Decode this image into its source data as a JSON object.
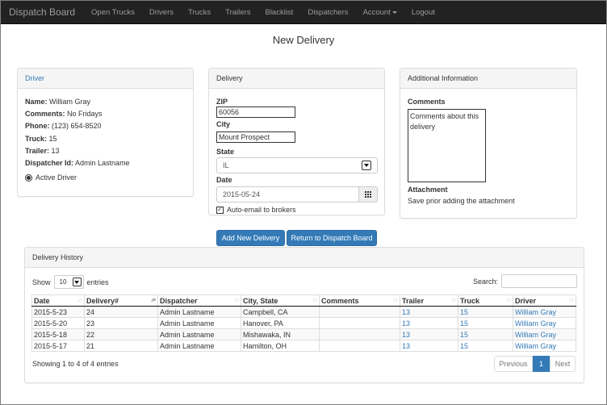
{
  "navbar": {
    "brand": "Dispatch Board",
    "items": [
      "Open Trucks",
      "Drivers",
      "Trucks",
      "Trailers",
      "Blacklist",
      "Dispatchers"
    ],
    "account": "Account",
    "logout": "Logout"
  },
  "page_title": "New Delivery",
  "driver_panel": {
    "heading": "Driver",
    "name_label": "Name:",
    "name": "William Gray",
    "comments_label": "Comments:",
    "comments": "No Fridays",
    "phone_label": "Phone:",
    "phone": "(123) 654-8520",
    "truck_label": "Truck:",
    "truck": "15",
    "trailer_label": "Trailer:",
    "trailer": "13",
    "dispatcher_label": "Dispatcher Id:",
    "dispatcher": "Admin Lastname",
    "active_label": "Active Driver"
  },
  "delivery_panel": {
    "heading": "Delivery",
    "zip_label": "ZIP",
    "zip": "60056",
    "city_label": "City",
    "city": "Mount Prospect",
    "state_label": "State",
    "state": "IL",
    "date_label": "Date",
    "date": "2015-05-24",
    "auto_email_label": "Auto-email to brokers",
    "auto_email_checked": true
  },
  "info_panel": {
    "heading": "Additional Information",
    "comments_label": "Comments",
    "comments_placeholder": "Comments about this delivery",
    "attachment_label": "Attachment",
    "attachment_note": "Save prior adding the attachment"
  },
  "buttons": {
    "add": "Add New Delivery",
    "return": "Return to Dispatch Board"
  },
  "history": {
    "heading": "Delivery History",
    "show_label": "Show",
    "entries_value": "10",
    "entries_label": "entries",
    "search_label": "Search:",
    "columns": [
      "Date",
      "Delivery#",
      "Dispatcher",
      "City, State",
      "Comments",
      "Trailer",
      "Truck",
      "Driver"
    ],
    "rows": [
      [
        "2015-5-23",
        "24",
        "Admin Lastname",
        "Campbell, CA",
        "",
        "13",
        "15",
        "William Gray"
      ],
      [
        "2015-5-20",
        "23",
        "Admin Lastname",
        "Hanover, PA",
        "",
        "13",
        "15",
        "William Gray"
      ],
      [
        "2015-5-18",
        "22",
        "Admin Lastname",
        "Mishawaka, IN",
        "",
        "13",
        "15",
        "William Gray"
      ],
      [
        "2015-5-17",
        "21",
        "Admin Lastname",
        "Hamilton, OH",
        "",
        "13",
        "15",
        "William Gray"
      ]
    ],
    "info": "Showing 1 to 4 of 4 entries",
    "pager": {
      "previous": "Previous",
      "page": "1",
      "next": "Next"
    }
  },
  "colors": {
    "navbar": "#222222",
    "primary": "#337ab7",
    "link": "#337ab7"
  }
}
